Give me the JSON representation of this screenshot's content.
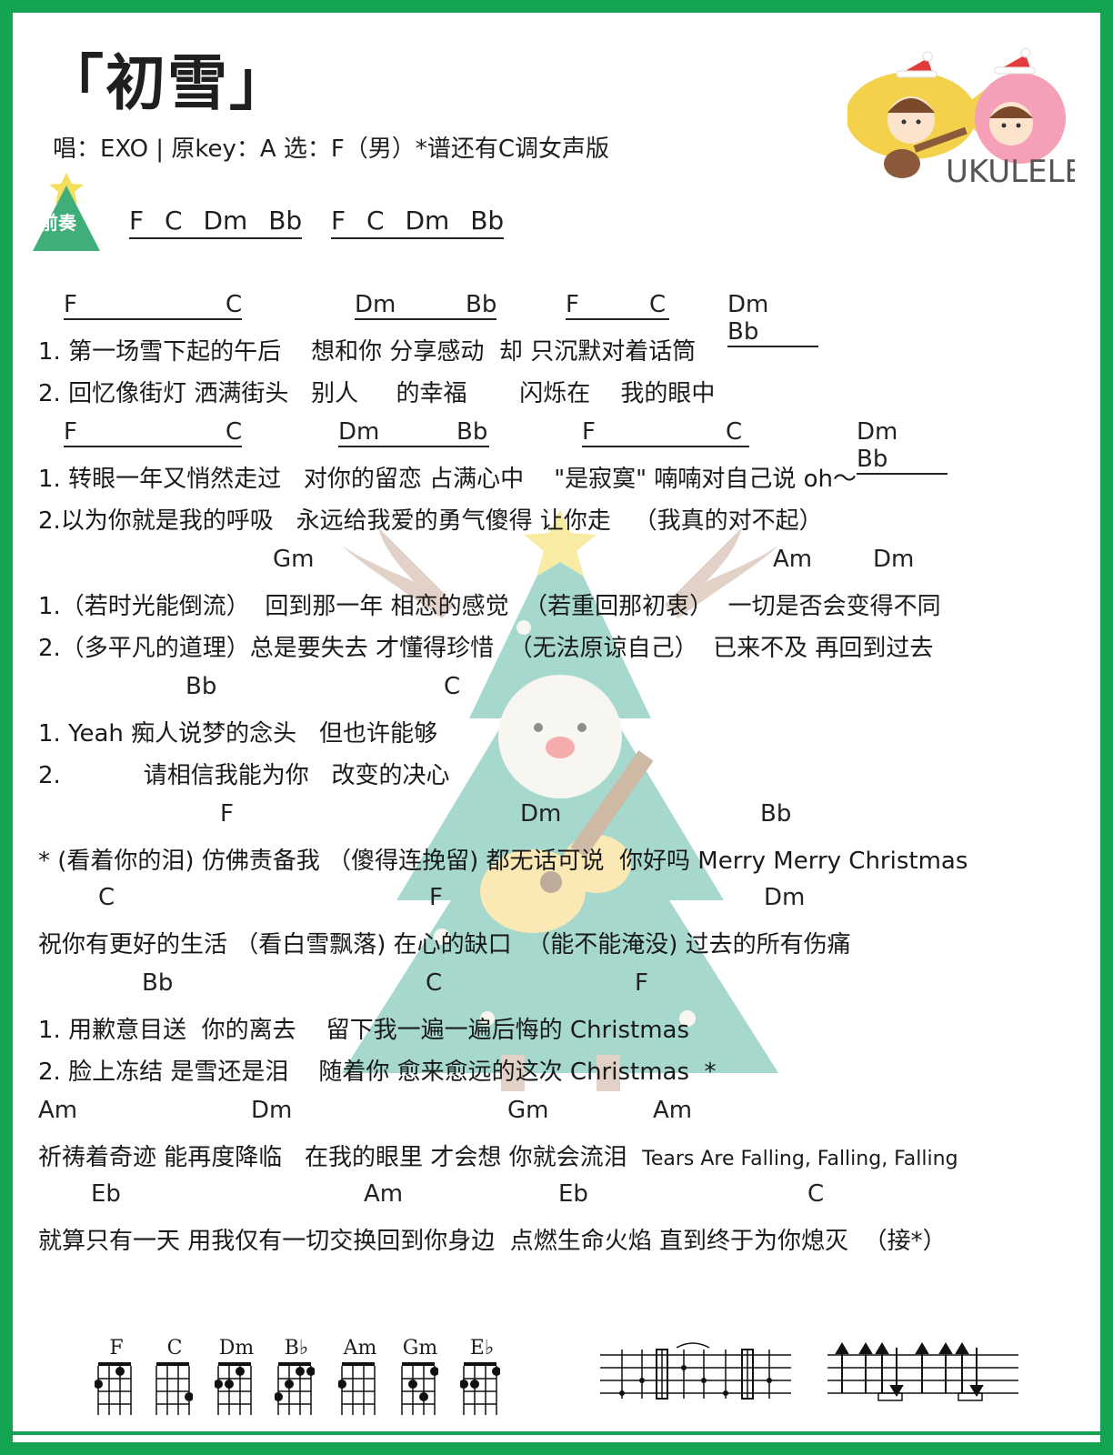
{
  "title": "「初雪」",
  "subtitle": "唱：EXO | 原key：A  选：F（男）*谱还有C调女声版",
  "logo": {
    "text": "UKULELE"
  },
  "intro": {
    "label": "前奏",
    "groups": [
      "F  C  Dm  Bb",
      "F  C  Dm  Bb"
    ]
  },
  "sections": [
    {
      "chords": [
        "F",
        "C",
        "Dm",
        "Bb",
        "F",
        "C",
        "Dm  Bb"
      ],
      "lines": [
        "1. 第一场雪下起的午后    想和你 分享感动  却 只沉默对着话筒",
        "2. 回忆像街灯 洒满街头   别人     的幸福       闪烁在    我的眼中"
      ]
    },
    {
      "chords": [
        "F",
        "C",
        "Dm",
        "Bb",
        "F",
        "C",
        "Dm  Bb"
      ],
      "lines": [
        "1. 转眼一年又悄然走过   对你的留恋 占满心中    \"是寂寞\" 喃喃对自己说 oh～",
        "2.以为你就是我的呼吸   永远给我爱的勇气傻得 让你走   （我真的对不起）"
      ]
    },
    {
      "chords": [
        "Gm",
        "Am",
        "Dm"
      ],
      "lines": [
        "1.（若时光能倒流）  回到那一年 相恋的感觉  （若重回那初衷）  一切是否会变得不同",
        "2.（多平凡的道理）总是要失去 才懂得珍惜  （无法原谅自己）  已来不及 再回到过去"
      ]
    },
    {
      "chords": [
        "Bb",
        "C"
      ],
      "lines": [
        "1. Yeah 痴人说梦的念头   但也许能够",
        "2.           请相信我能为你   改变的决心"
      ]
    },
    {
      "chords": [
        "F",
        "Dm",
        "Bb"
      ],
      "lines": [
        "* (看着你的泪) 仿佛责备我 （傻得连挽留) 都无话可说  你好吗 Merry Merry Christmas"
      ]
    },
    {
      "chords": [
        "C",
        "F",
        "Dm"
      ],
      "lines": [
        "祝你有更好的生活 （看白雪飘落) 在心的缺口  （能不能淹没) 过去的所有伤痛"
      ]
    },
    {
      "chords": [
        "Bb",
        "C",
        "F"
      ],
      "lines": [
        "1. 用歉意目送  你的离去    留下我一遍一遍后悔的 Christmas",
        "2. 脸上冻结 是雪还是泪    随着你 愈来愈远的这次 Christmas  *"
      ]
    },
    {
      "chords": [
        "Am",
        "Dm",
        "Gm",
        "Am"
      ],
      "lines": [
        "祈祷着奇迹 能再度降临   在我的眼里 才会想 你就会流泪  "
      ],
      "line_small": "Tears Are Falling, Falling, Falling"
    },
    {
      "chords": [
        "Eb",
        "Am",
        "Eb",
        "C"
      ],
      "lines": [
        "就算只有一天 用我仅有一切交换回到你身边  点燃生命火焰 直到终于为你熄灭  （接*）"
      ]
    }
  ],
  "chord_diagrams": [
    "F",
    "C",
    "Dm",
    "B♭",
    "Am",
    "Gm",
    "E♭"
  ],
  "colors": {
    "frame": "#15a552",
    "tree": "#4fb6a0",
    "star": "#f4de5a"
  }
}
